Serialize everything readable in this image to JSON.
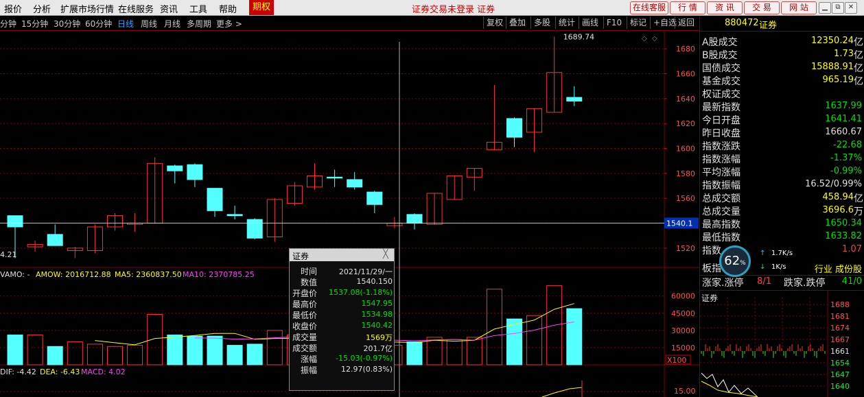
{
  "menu": {
    "items": [
      "报价",
      "分析",
      "扩展市场行情",
      "在线服务",
      "资讯",
      "工具",
      "帮助"
    ],
    "qq_label": "期权",
    "login_text": "证券交易未登录  证券",
    "top_buttons": [
      "在线客服",
      "行  情",
      "资  讯",
      "交  易",
      "网  站"
    ],
    "window_buttons": [
      "▁",
      "⧉",
      "✕",
      "⊗"
    ]
  },
  "toolbar": {
    "periods": [
      "分钟",
      "15分钟",
      "30分钟",
      "60分钟",
      "日线",
      "周线",
      "月线",
      "多周期",
      "更多 >"
    ],
    "active_period": "日线",
    "right_buttons": [
      "复权",
      "叠加",
      "多股",
      "统计",
      "画线",
      "F10",
      "标记",
      "+自选",
      "返回"
    ]
  },
  "chart": {
    "high_label": "1689.74",
    "low_label": "4.21",
    "price_ticks": [
      "1680",
      "1660",
      "1640",
      "1620",
      "1600",
      "1580",
      "1560",
      "1540",
      "1520"
    ],
    "crosshair_value": "1540.1",
    "vol_legend": {
      "vamo": "VAMO: -",
      "amow": "AMOW: 2016712.88",
      "ma5": "MA5: 2360837.50",
      "ma10": "MA10: 2370785.25"
    },
    "vol_ticks": [
      "60000",
      "45000",
      "30000",
      "15000"
    ],
    "vol_unit": "X100",
    "macd_legend": {
      "dif": "DIF: -4.42",
      "dea": "DEA: -6.43",
      "macd": "MACD: 4.02"
    },
    "macd_tick": "15.00",
    "colors": {
      "up": "#ff3333",
      "down": "#54ffff",
      "ma5": "#ffff00",
      "ma10": "#ff40ff",
      "grid": "#800000"
    }
  },
  "chart_data": {
    "type": "candlestick",
    "title": "证券",
    "y_range": [
      1510,
      1690
    ],
    "candles": [
      {
        "o": 1537,
        "h": 1546,
        "l": 1512,
        "c": 1546,
        "up": false
      },
      {
        "o": 1523,
        "h": 1526,
        "l": 1517,
        "c": 1521,
        "up": true
      },
      {
        "o": 1531,
        "h": 1539,
        "l": 1522,
        "c": 1522,
        "up": false
      },
      {
        "o": 1518,
        "h": 1521,
        "l": 1512,
        "c": 1520,
        "up": true
      },
      {
        "o": 1518,
        "h": 1539,
        "l": 1516,
        "c": 1537,
        "up": true
      },
      {
        "o": 1537,
        "h": 1548,
        "l": 1534,
        "c": 1546,
        "up": true
      },
      {
        "o": 1540,
        "h": 1548,
        "l": 1533,
        "c": 1539,
        "up": true
      },
      {
        "o": 1540,
        "h": 1593,
        "l": 1540,
        "c": 1588,
        "up": true
      },
      {
        "o": 1586,
        "h": 1587,
        "l": 1572,
        "c": 1582,
        "up": false
      },
      {
        "o": 1587,
        "h": 1588,
        "l": 1569,
        "c": 1575,
        "up": false
      },
      {
        "o": 1568,
        "h": 1568,
        "l": 1545,
        "c": 1550,
        "up": false
      },
      {
        "o": 1546,
        "h": 1554,
        "l": 1543,
        "c": 1547,
        "up": false
      },
      {
        "o": 1543,
        "h": 1544,
        "l": 1527,
        "c": 1528,
        "up": false
      },
      {
        "o": 1529,
        "h": 1560,
        "l": 1525,
        "c": 1559,
        "up": true
      },
      {
        "o": 1556,
        "h": 1573,
        "l": 1554,
        "c": 1570,
        "up": true
      },
      {
        "o": 1569,
        "h": 1588,
        "l": 1567,
        "c": 1578,
        "up": true
      },
      {
        "o": 1577,
        "h": 1583,
        "l": 1569,
        "c": 1577,
        "up": false
      },
      {
        "o": 1575,
        "h": 1581,
        "l": 1567,
        "c": 1569,
        "up": false
      },
      {
        "o": 1565,
        "h": 1566,
        "l": 1548,
        "c": 1555,
        "up": false
      },
      {
        "o": 1538,
        "h": 1545,
        "l": 1536,
        "c": 1540,
        "up": true
      },
      {
        "o": 1547,
        "h": 1548,
        "l": 1535,
        "c": 1540,
        "up": false
      },
      {
        "o": 1539,
        "h": 1564,
        "l": 1539,
        "c": 1564,
        "up": true
      },
      {
        "o": 1559,
        "h": 1578,
        "l": 1559,
        "c": 1578,
        "up": true
      },
      {
        "o": 1577,
        "h": 1584,
        "l": 1566,
        "c": 1584,
        "up": true
      },
      {
        "o": 1599,
        "h": 1651,
        "l": 1599,
        "c": 1605,
        "up": true
      },
      {
        "o": 1624,
        "h": 1625,
        "l": 1601,
        "c": 1609,
        "up": false
      },
      {
        "o": 1613,
        "h": 1632,
        "l": 1597,
        "c": 1632,
        "up": true
      },
      {
        "o": 1629,
        "h": 1689.74,
        "l": 1629,
        "c": 1661,
        "up": true
      },
      {
        "o": 1641,
        "h": 1650,
        "l": 1634,
        "c": 1638,
        "up": false
      }
    ],
    "volumes": [
      26000,
      26000,
      16000,
      20000,
      18000,
      16000,
      17000,
      44000,
      26000,
      25000,
      25000,
      17000,
      18000,
      30000,
      26000,
      22000,
      14000,
      26000,
      20000,
      17000,
      20000,
      24000,
      22000,
      24000,
      66000,
      40000,
      43000,
      69000,
      49000
    ]
  },
  "tooltip": {
    "title": "证券",
    "close_symbol": "╳",
    "rows": [
      {
        "label": "时间",
        "value": "2021/11/29/一",
        "color": "wht"
      },
      {
        "label": "数值",
        "value": "1540.150",
        "color": "wht"
      },
      {
        "label": "开盘价",
        "value": "1537.08(-1.18%)",
        "color": "grn"
      },
      {
        "label": "最高价",
        "value": "1547.95",
        "color": "grn"
      },
      {
        "label": "最低价",
        "value": "1534.98",
        "color": "grn"
      },
      {
        "label": "收盘价",
        "value": "1540.42",
        "color": "grn"
      },
      {
        "label": "成交量",
        "value": "1569万",
        "color": "yel"
      },
      {
        "label": "成交额",
        "value": "201.7亿",
        "color": "wht"
      },
      {
        "label": "涨幅",
        "value": "-15.03(-0.97%)",
        "color": "grn"
      },
      {
        "label": "振幅",
        "value": "12.97(0.83%)",
        "color": "wht"
      }
    ]
  },
  "side": {
    "code": "880472",
    "name": "证券",
    "rows": [
      {
        "label": "A股成交",
        "value": "12350.24",
        "unit": "亿",
        "color": "yel"
      },
      {
        "label": "B股成交",
        "value": "1.73",
        "unit": "亿",
        "color": "yel"
      },
      {
        "label": "国债成交",
        "value": "15888.91",
        "unit": "亿",
        "color": "yel"
      },
      {
        "label": "基金成交",
        "value": "965.19",
        "unit": "亿",
        "color": "yel"
      },
      {
        "label": "权证成交",
        "value": "",
        "unit": "",
        "color": "yel"
      },
      {
        "label": "最新指数",
        "value": "1637.99",
        "unit": "",
        "color": "grn"
      },
      {
        "label": "今日开盘",
        "value": "1641.41",
        "unit": "",
        "color": "grn"
      },
      {
        "label": "昨日收盘",
        "value": "1660.67",
        "unit": "",
        "color": "wht"
      },
      {
        "label": "指数涨跌",
        "value": "-22.68",
        "unit": "",
        "color": "grn"
      },
      {
        "label": "指数涨幅",
        "value": "-1.37%",
        "unit": "",
        "color": "grn"
      },
      {
        "label": "平均涨幅",
        "value": "-0.99%",
        "unit": "",
        "color": "grn"
      },
      {
        "label": "指数振幅",
        "value": "16.52/0.99%",
        "unit": "",
        "color": "wht"
      },
      {
        "label": "总成交额",
        "value": "458.94",
        "unit": "亿",
        "color": "yel"
      },
      {
        "label": "总成交量",
        "value": "3696.6",
        "unit": "万",
        "color": "yel"
      },
      {
        "label": "最高指数",
        "value": "1650.34",
        "unit": "",
        "color": "grn"
      },
      {
        "label": "最低指数",
        "value": "1633.82",
        "unit": "",
        "color": "grn"
      },
      {
        "label": "指数",
        "value": "1.07",
        "unit": "",
        "color": "red"
      }
    ],
    "row_bk_label": "板指",
    "row_bk_right": "行业 成份股",
    "row_zd": {
      "label": "涨家.涨停",
      "value": "8/1",
      "label2": "跌家.跌停",
      "value2": "41/0"
    },
    "mini_title": "证券",
    "mini_ticks": [
      "1688",
      "1681",
      "1674",
      "1667",
      "1661",
      "1654",
      "1647",
      "1640"
    ]
  },
  "gauge": {
    "percent": "62",
    "pct_sign": "%",
    "up_speed": "1.7K/s",
    "down_speed": "1K/s"
  }
}
